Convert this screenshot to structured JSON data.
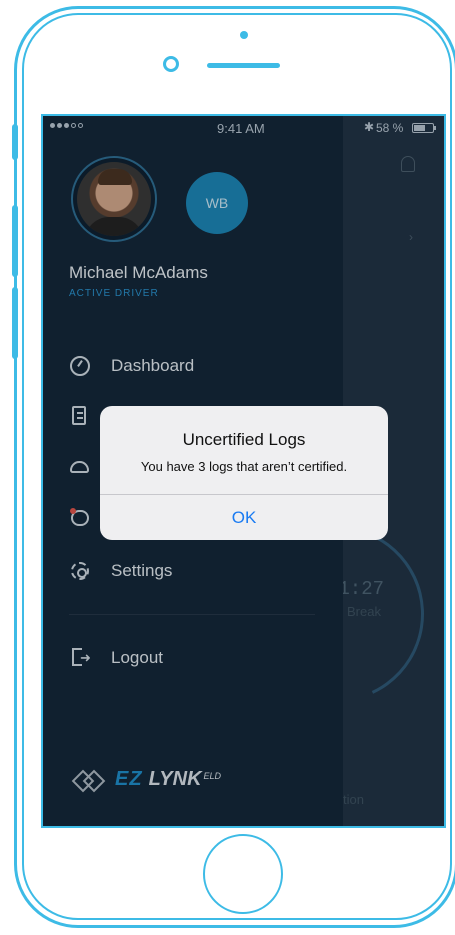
{
  "status_bar": {
    "time": "9:41 AM",
    "bluetooth_symbol": "✱",
    "battery_text": "58 %",
    "signal_dots_filled": 3,
    "signal_dots_total": 5
  },
  "profile": {
    "initials": "WB",
    "name": "Michael McAdams",
    "status": "ACTIVE DRIVER"
  },
  "menu": {
    "items": [
      {
        "label": "Dashboard",
        "icon": "dashboard-icon"
      },
      {
        "label": "",
        "icon": "logs-icon"
      },
      {
        "label": "",
        "icon": "driver-cap-icon"
      },
      {
        "label": "",
        "icon": "messages-icon"
      },
      {
        "label": "Settings",
        "icon": "gear-icon"
      }
    ],
    "logout_label": "Logout"
  },
  "logo": {
    "ez": "EZ",
    "lynk": "LYNK",
    "eld": "ELD"
  },
  "background_app": {
    "timer": "01:27",
    "timer_label": "Break",
    "bottom_text": "tion"
  },
  "alert": {
    "title": "Uncertified Logs",
    "message": "You have 3 logs that aren’t certified.",
    "ok_label": "OK"
  },
  "colors": {
    "accent": "#3dbbe6",
    "drawer_bg": "#14283a",
    "link_blue": "#1a7bf2"
  }
}
